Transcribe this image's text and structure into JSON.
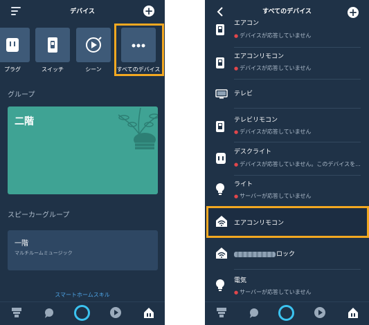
{
  "left_screen": {
    "title": "デバイス",
    "categories": [
      {
        "label": "プラグ",
        "icon": "plug-icon"
      },
      {
        "label": "スイッチ",
        "icon": "switch-icon"
      },
      {
        "label": "シーン",
        "icon": "scene-play-icon"
      },
      {
        "label": "すべてのデバイス",
        "icon": "more-dots-icon"
      }
    ],
    "group_section_title": "グループ",
    "group_name": "二階",
    "speaker_section_title": "スピーカーグループ",
    "speaker_group": {
      "name": "一階",
      "subtitle": "マルチルームミュージック"
    },
    "skill_link": "スマートホームスキル"
  },
  "right_screen": {
    "title": "すべてのデバイス",
    "devices": [
      {
        "name": "エアコン",
        "status": "デバイスが応答していません",
        "icon": "switch-icon"
      },
      {
        "name": "エアコンリモコン",
        "status": "デバイスが応答していません",
        "icon": "switch-icon"
      },
      {
        "name": "テレビ",
        "status": "",
        "icon": "tv-icon"
      },
      {
        "name": "テレビリモコン",
        "status": "デバイスが応答していません",
        "icon": "switch-icon"
      },
      {
        "name": "デスクライト",
        "status": "デバイスが応答していません。このデバイスを...",
        "icon": "plug-icon"
      },
      {
        "name": "ライト",
        "status": "サーバーが応答していません",
        "icon": "bulb-icon"
      },
      {
        "name": "エアコンリモコン",
        "status": "",
        "icon": "home-wifi-icon"
      },
      {
        "name": "ロック",
        "status": "",
        "icon": "home-wifi-icon"
      },
      {
        "name": "電気",
        "status": "サーバーが応答していません",
        "icon": "bulb-icon"
      }
    ]
  },
  "bottom_nav": [
    "home-icon",
    "chat-icon",
    "alexa-icon",
    "play-icon",
    "devices-icon"
  ],
  "colors": {
    "background": "#1f3247",
    "tile": "#3e5a78",
    "group_card": "#3fa394",
    "highlight": "#f3a821",
    "link": "#4fa6e8",
    "error_dot": "#e1464b",
    "alexa": "#3bc3f0"
  }
}
